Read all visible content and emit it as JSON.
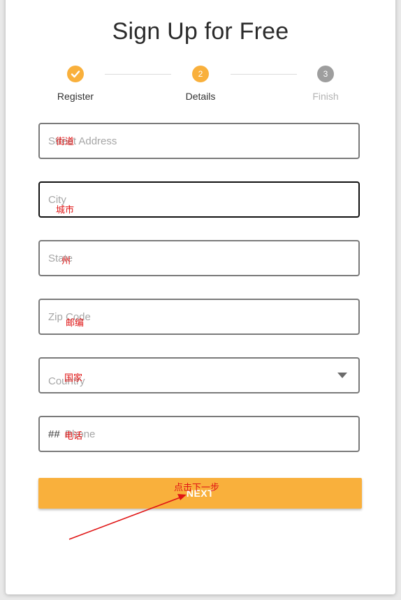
{
  "title": "Sign Up for Free",
  "stepper": {
    "steps": [
      {
        "label": "Register",
        "state": "done",
        "marker": "✓"
      },
      {
        "label": "Details",
        "state": "active",
        "marker": "2"
      },
      {
        "label": "Finish",
        "state": "inactive",
        "marker": "3"
      }
    ]
  },
  "form": {
    "street": {
      "placeholder": "Street Address",
      "annotation": "街道"
    },
    "city": {
      "placeholder": "City",
      "annotation": "城市"
    },
    "state": {
      "placeholder": "State",
      "annotation": "州"
    },
    "zip": {
      "placeholder": "Zip Code",
      "annotation": "邮编"
    },
    "country": {
      "placeholder": "Country",
      "annotation": "国家"
    },
    "phone": {
      "prefix": "##",
      "placeholder": "Phone",
      "annotation": "电话"
    }
  },
  "next_button": {
    "label": "NEXT",
    "annotation": "点击下一步"
  },
  "colors": {
    "accent": "#f9b03c",
    "inactive_step": "#9e9e9e",
    "annotation": "#e01515"
  },
  "icons": {
    "check": "check-icon",
    "dropdown": "chevron-down-icon"
  }
}
